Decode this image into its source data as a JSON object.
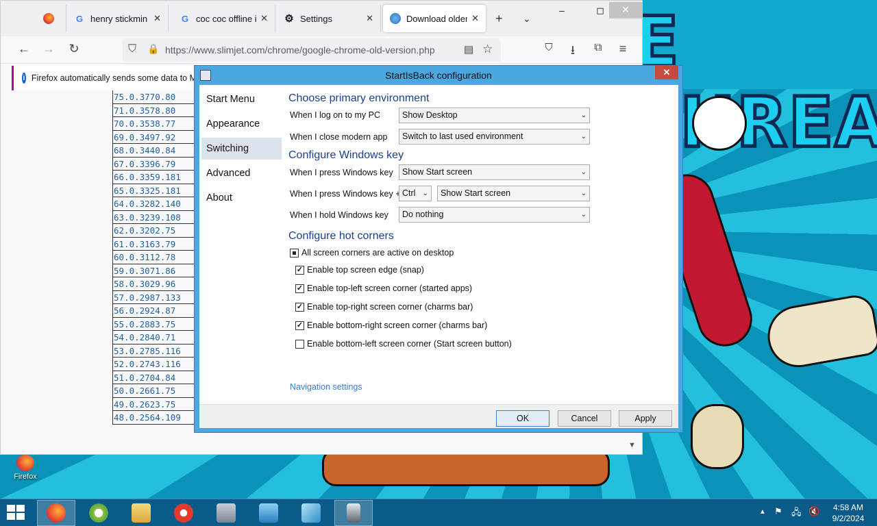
{
  "browser": {
    "tabs": [
      {
        "label": "",
        "icon": "firefox-icon"
      },
      {
        "label": "henry stickmin trip",
        "icon": "google-icon"
      },
      {
        "label": "coc coc offline ins",
        "icon": "google-icon"
      },
      {
        "label": "Settings",
        "icon": "gear-icon"
      },
      {
        "label": "Download older v",
        "icon": "globe-icon"
      }
    ],
    "url": "https://www.slimjet.com/chrome/google-chrome-old-version.php",
    "notification": "Firefox automatically sends some data to M"
  },
  "versions": [
    "75.0.3770.80",
    "71.0.3578.80",
    "70.0.3538.77",
    "69.0.3497.92",
    "68.0.3440.84",
    "67.0.3396.79",
    "66.0.3359.181",
    "65.0.3325.181",
    "64.0.3282.140",
    "63.0.3239.108",
    "62.0.3202.75",
    "61.0.3163.79",
    "60.0.3112.78",
    "59.0.3071.86",
    "58.0.3029.96",
    "57.0.2987.133",
    "56.0.2924.87",
    "55.0.2883.75",
    "54.0.2840.71",
    "53.0.2785.116",
    "52.0.2743.116",
    "51.0.2704.84",
    "50.0.2661.75",
    "49.0.2623.75",
    "48.0.2564.109"
  ],
  "dialog": {
    "title": "StartIsBack configuration",
    "close": "✕",
    "sidebar": [
      "Start Menu",
      "Appearance",
      "Switching",
      "Advanced",
      "About"
    ],
    "selected_index": 2,
    "sec1": "Choose primary environment",
    "logon_label": "When I log on to my PC",
    "logon_value": "Show Desktop",
    "close_label": "When I close modern app",
    "close_value": "Switch to last used environment",
    "sec2": "Configure Windows key",
    "press_label": "When I press Windows key",
    "press_value": "Show Start screen",
    "pressplus_label": "When I press Windows key +",
    "modifier_value": "Ctrl",
    "pressplus_value": "Show Start screen",
    "hold_label": "When I hold Windows key",
    "hold_value": "Do nothing",
    "sec3": "Configure hot corners",
    "all_corners": "All screen corners are active on desktop",
    "opt1": "Enable top screen edge (snap)",
    "opt2": "Enable top-left screen corner (started apps)",
    "opt3": "Enable top-right screen corner (charms bar)",
    "opt4": "Enable bottom-right screen corner (charms bar)",
    "opt5": "Enable bottom-left screen corner (Start screen button)",
    "nav_link": "Navigation settings",
    "ok": "OK",
    "cancel": "Cancel",
    "apply": "Apply"
  },
  "desktop": {
    "icon_label": "Firefox",
    "art_text": "E THREAT"
  },
  "taskbar": {
    "time": "4:58 AM",
    "date": "9/2/2024"
  }
}
